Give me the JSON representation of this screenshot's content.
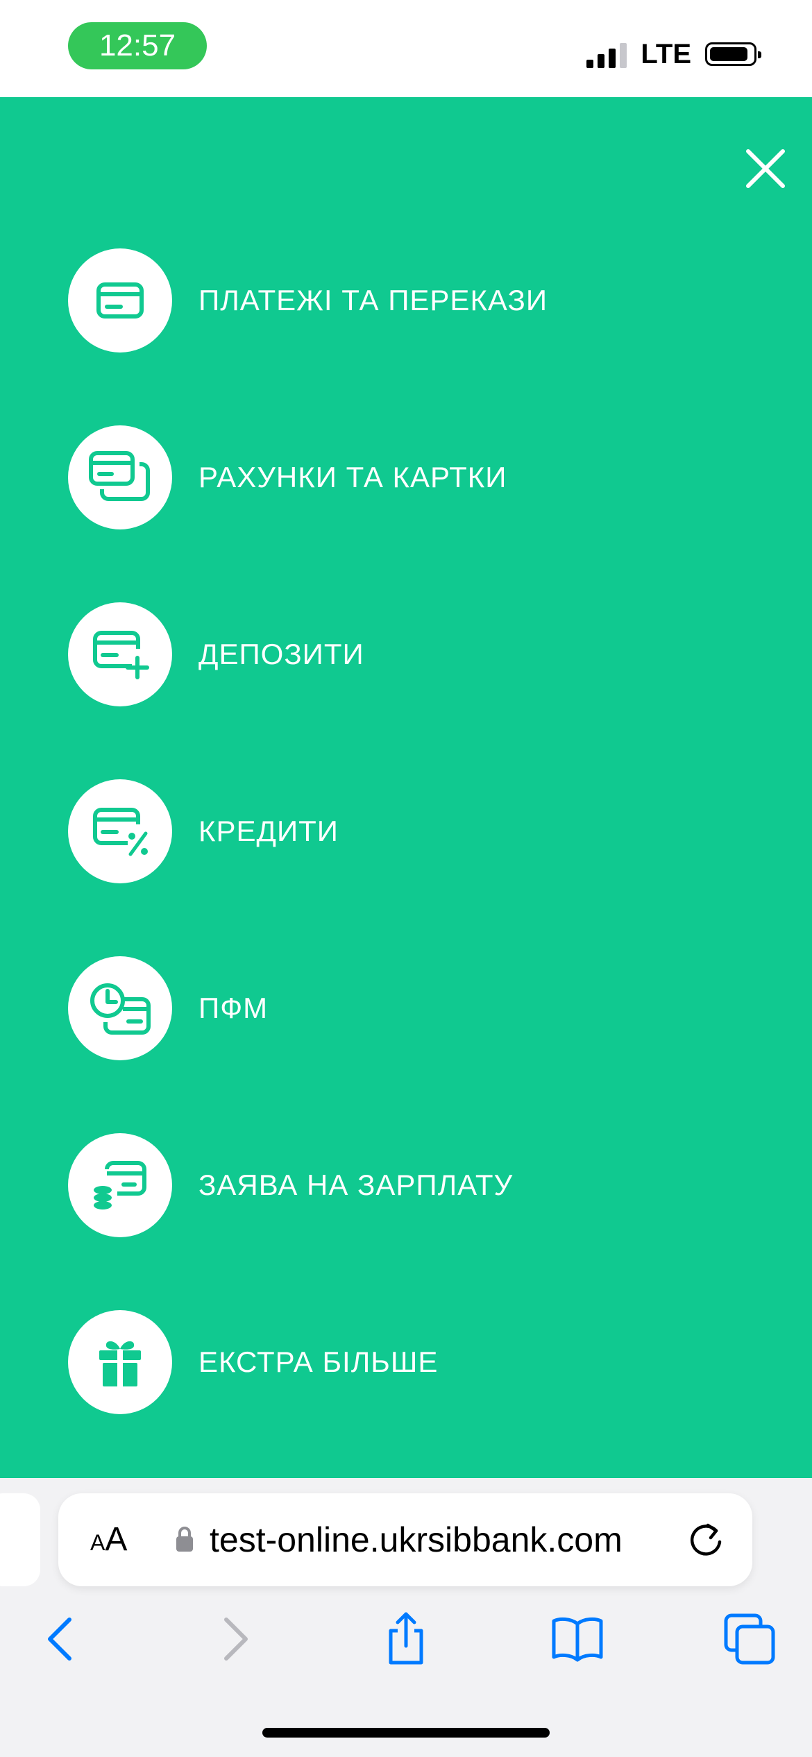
{
  "status_bar": {
    "time": "12:57",
    "network": "LTE",
    "time_pill_color": "#34c759"
  },
  "menu": {
    "background_color": "#10c990",
    "close_icon": "close-icon",
    "items": [
      {
        "label": "ПЛАТЕЖІ ТА ПЕРЕКАЗИ",
        "icon": "card-icon"
      },
      {
        "label": "РАХУНКИ ТА КАРТКИ",
        "icon": "cards-stack-icon"
      },
      {
        "label": "ДЕПОЗИТИ",
        "icon": "card-plus-icon"
      },
      {
        "label": "КРЕДИТИ",
        "icon": "card-percent-icon"
      },
      {
        "label": "ПФМ",
        "icon": "clock-card-icon"
      },
      {
        "label": "ЗАЯВА НА ЗАРПЛАТУ",
        "icon": "card-coins-icon"
      },
      {
        "label": "ЕКСТРА БІЛЬШЕ",
        "icon": "gift-icon"
      }
    ]
  },
  "browser": {
    "text_size_button": {
      "small": "A",
      "big": "A"
    },
    "url": "test-online.ukrsibbank.com",
    "accent_color": "#007aff",
    "toolbar": [
      "back-icon",
      "forward-icon",
      "share-icon",
      "bookmarks-icon",
      "tabs-icon"
    ]
  }
}
